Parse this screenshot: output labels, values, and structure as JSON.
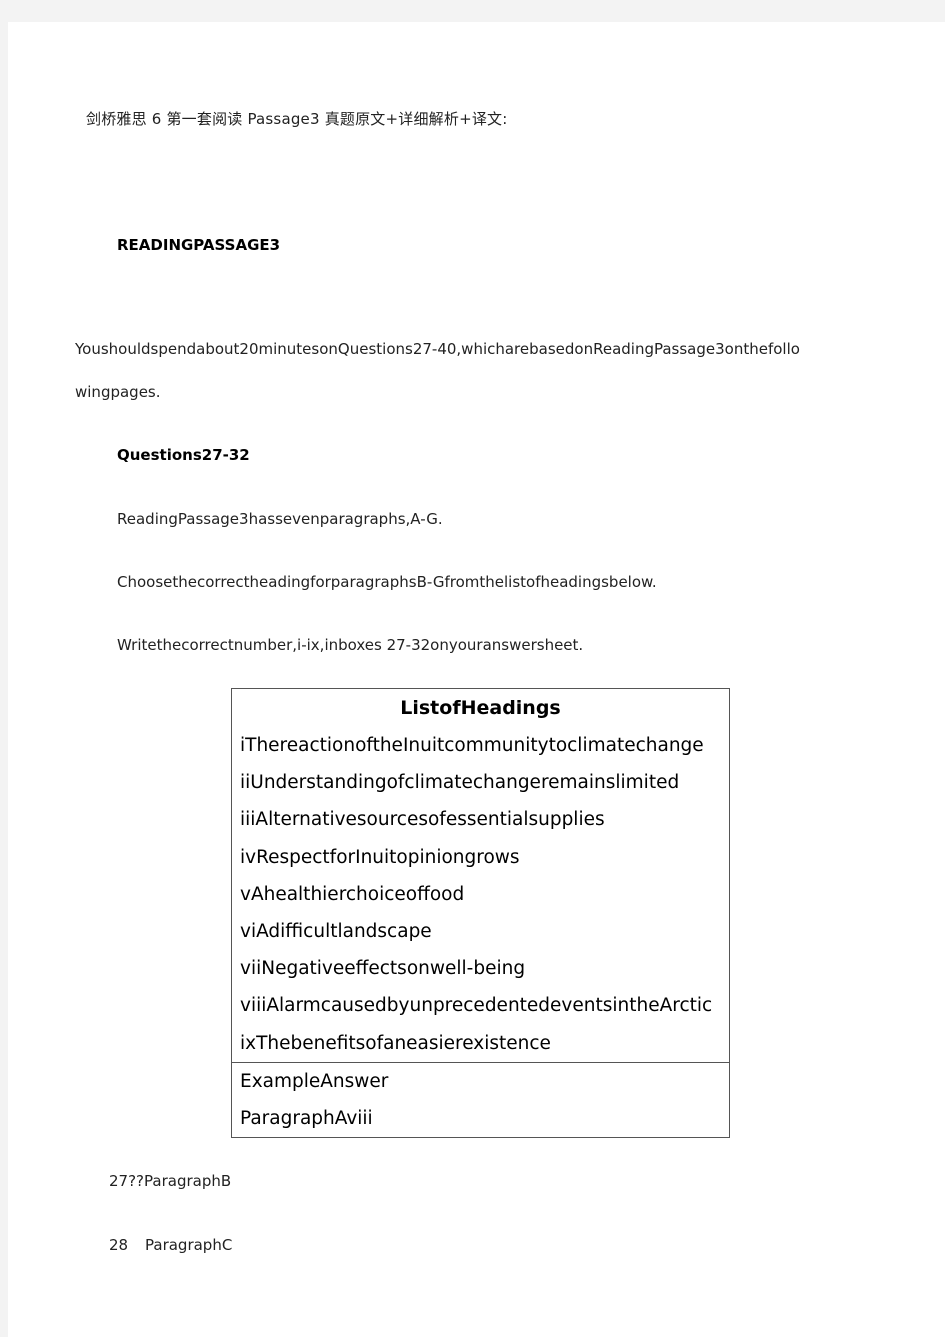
{
  "document": {
    "title": "剑桥雅思 6 第一套阅读 Passage3 真题原文+详细解析+译文:",
    "section_heading": "READINGPASSAGE3",
    "intro_text": "YoushouldspendaboutminutesonQuestions27-40,whicharebasedonReadingPassage3onthefollowingpages.",
    "intro_line1": "Youshouldspendabout20minutesonQuestions27-40,whicharebasedonReadingPassage3onthefollo",
    "intro_line2": "wingpages.",
    "questions_heading": "Questions27-32",
    "instructions": [
      "ReadingPassage3hassevenparagraphs,A-G.",
      "ChoosethecorrectheadingforparagraphsB-Gfromthelistofheadingsbelow.",
      "Writethecorrectnumber,i-ix,inboxes  27-32onyouranswersheet."
    ],
    "headings_box": {
      "title": "ListofHeadings",
      "items": [
        "iThereactionoftheInuitcommunitytoclimatechange",
        "iiUnderstandingofclimatechangeremainslimited",
        "iiiAlternativesourcesofessentialsupplies",
        "ivRespectforInuitopiniongrows",
        "vAhealthierchoiceoffood",
        "viAdifficultlandscape",
        "viiNegativeeffectsonwell-being",
        "viiiAlarmcausedbyunprecedentedeventsintheArctic",
        "ixThebenefitsofaneasierexistence"
      ],
      "example_label": "ExampleAnswer",
      "example_value": "ParagraphAviii"
    },
    "questions": [
      {
        "number": "27??",
        "label": "ParagraphB"
      },
      {
        "number": "28",
        "label": "ParagraphC"
      }
    ]
  }
}
